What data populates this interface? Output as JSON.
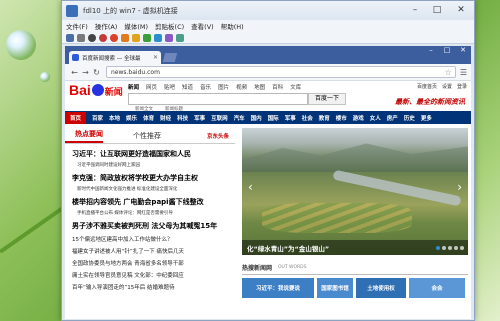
{
  "vm": {
    "title": "fdl10 上的 win7 - 虚拟机连接",
    "menu": [
      "文件(F)",
      "操作(A)",
      "媒体(M)",
      "剪贴板(C)",
      "查看(V)",
      "帮助(H)"
    ]
  },
  "browser": {
    "tab_title": "百度新闻搜索 — 全球最",
    "url": "news.baidu.com"
  },
  "baidu": {
    "logo_left": "Bai",
    "logo_right": "新闻",
    "nav": [
      "新闻",
      "网页",
      "贴吧",
      "知道",
      "音乐",
      "图片",
      "视频",
      "地图",
      "百科",
      "文库"
    ],
    "top_links": [
      "百度首页",
      "设置",
      "登录"
    ],
    "search_button": "百度一下",
    "radios": [
      "新闻全文",
      "新闻标题"
    ],
    "slogan": "最新、最全的新闻资讯",
    "channels": [
      "首页",
      "百家",
      "本地",
      "娱乐",
      "体育",
      "财经",
      "科技",
      "军事",
      "互联网",
      "汽车",
      "国内",
      "国际",
      "军事",
      "社会",
      "教育",
      "楼市",
      "游戏",
      "女人",
      "房产",
      "历史",
      "更多"
    ]
  },
  "left": {
    "tabs": [
      "热点要闻",
      "个性推荐"
    ],
    "tag": "京东头条",
    "h1": "习近平：让互联网更好造福国家和人民",
    "h1_sub": "习近平强调同时建设好网上家园",
    "h2": "李克强：简政放权将学校更大办学自主权",
    "h2_sub": "新时代中国新闻文化强力推进    标准化建设全面深化",
    "h3": "楼举招内容领先 广电勤会papi酱下线整改",
    "h3_sub": "手机直播平台公布 媒体评论：网红是否需要引导",
    "h4": "男子涉不雅买卖被判死刑 法父母为其喊冤15年",
    "items": [
      "15个偏远地区建高中加入工作站做什么？",
      "福建女子讲述被人用“针”扎了一下 痛快后几天",
      "全国政协委员与地方两会 青海省多名领导干部",
      "庸土实在领导官员意见稿 文化部：中纪委回应",
      "百年“输入导演团走的”15年后 结婚难题待"
    ]
  },
  "right": {
    "caption": "化“绿水青山”为“金山银山”",
    "local_title": "热搜新闻网",
    "local_sub": "OUT WORDS",
    "cards": [
      "习近平：我说要说",
      "国家图书馆",
      "土地使用权",
      "会会"
    ]
  },
  "colors": {
    "channel_bg": "#003377",
    "accent_red": "#cc0000",
    "tabstrip": "#3c5e9e"
  }
}
